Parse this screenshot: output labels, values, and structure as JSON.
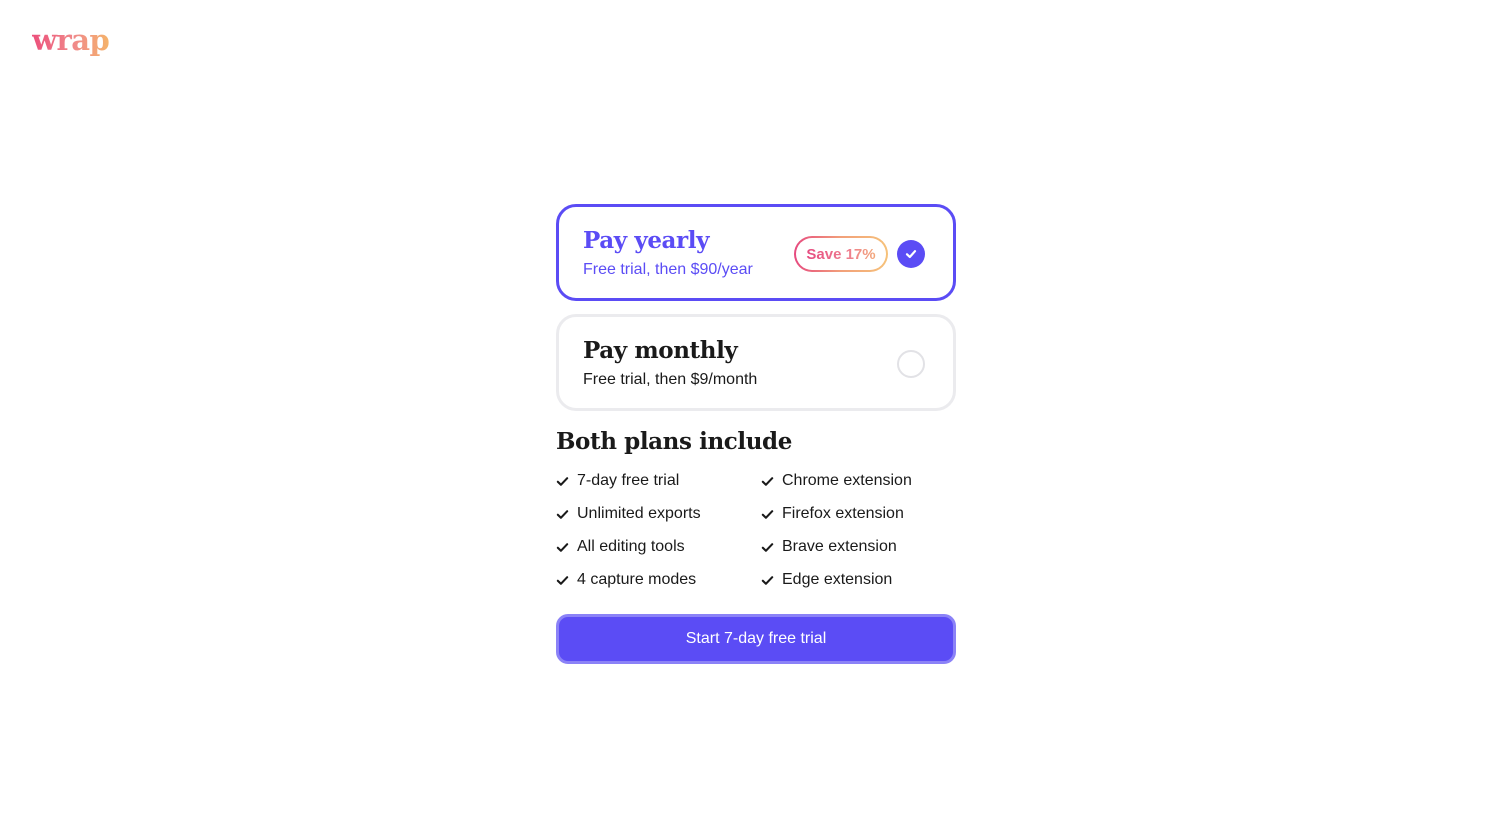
{
  "brand": {
    "logo_text": "wrap"
  },
  "plans": [
    {
      "title": "Pay yearly",
      "subtitle": "Free trial, then $90/year",
      "badge": "Save 17%",
      "selected": true
    },
    {
      "title": "Pay monthly",
      "subtitle": "Free trial, then $9/month",
      "selected": false
    }
  ],
  "features": {
    "title": "Both plans include",
    "items": [
      "7-day free trial",
      "Chrome extension",
      "Unlimited exports",
      "Firefox extension",
      "All editing tools",
      "Brave extension",
      "4 capture modes",
      "Edge extension"
    ]
  },
  "cta": {
    "label": "Start 7-day free trial"
  },
  "colors": {
    "accent": "#5b4cf5",
    "accent_border": "#8b82f7",
    "text": "#1a1a1a",
    "muted_border": "#ebebee",
    "badge_gradient_start": "#e6497f",
    "badge_gradient_end": "#f6c27a"
  },
  "icons": {
    "check": "check-icon",
    "radio_checked": "radio-checked-icon",
    "radio_empty": "radio-empty-icon"
  }
}
